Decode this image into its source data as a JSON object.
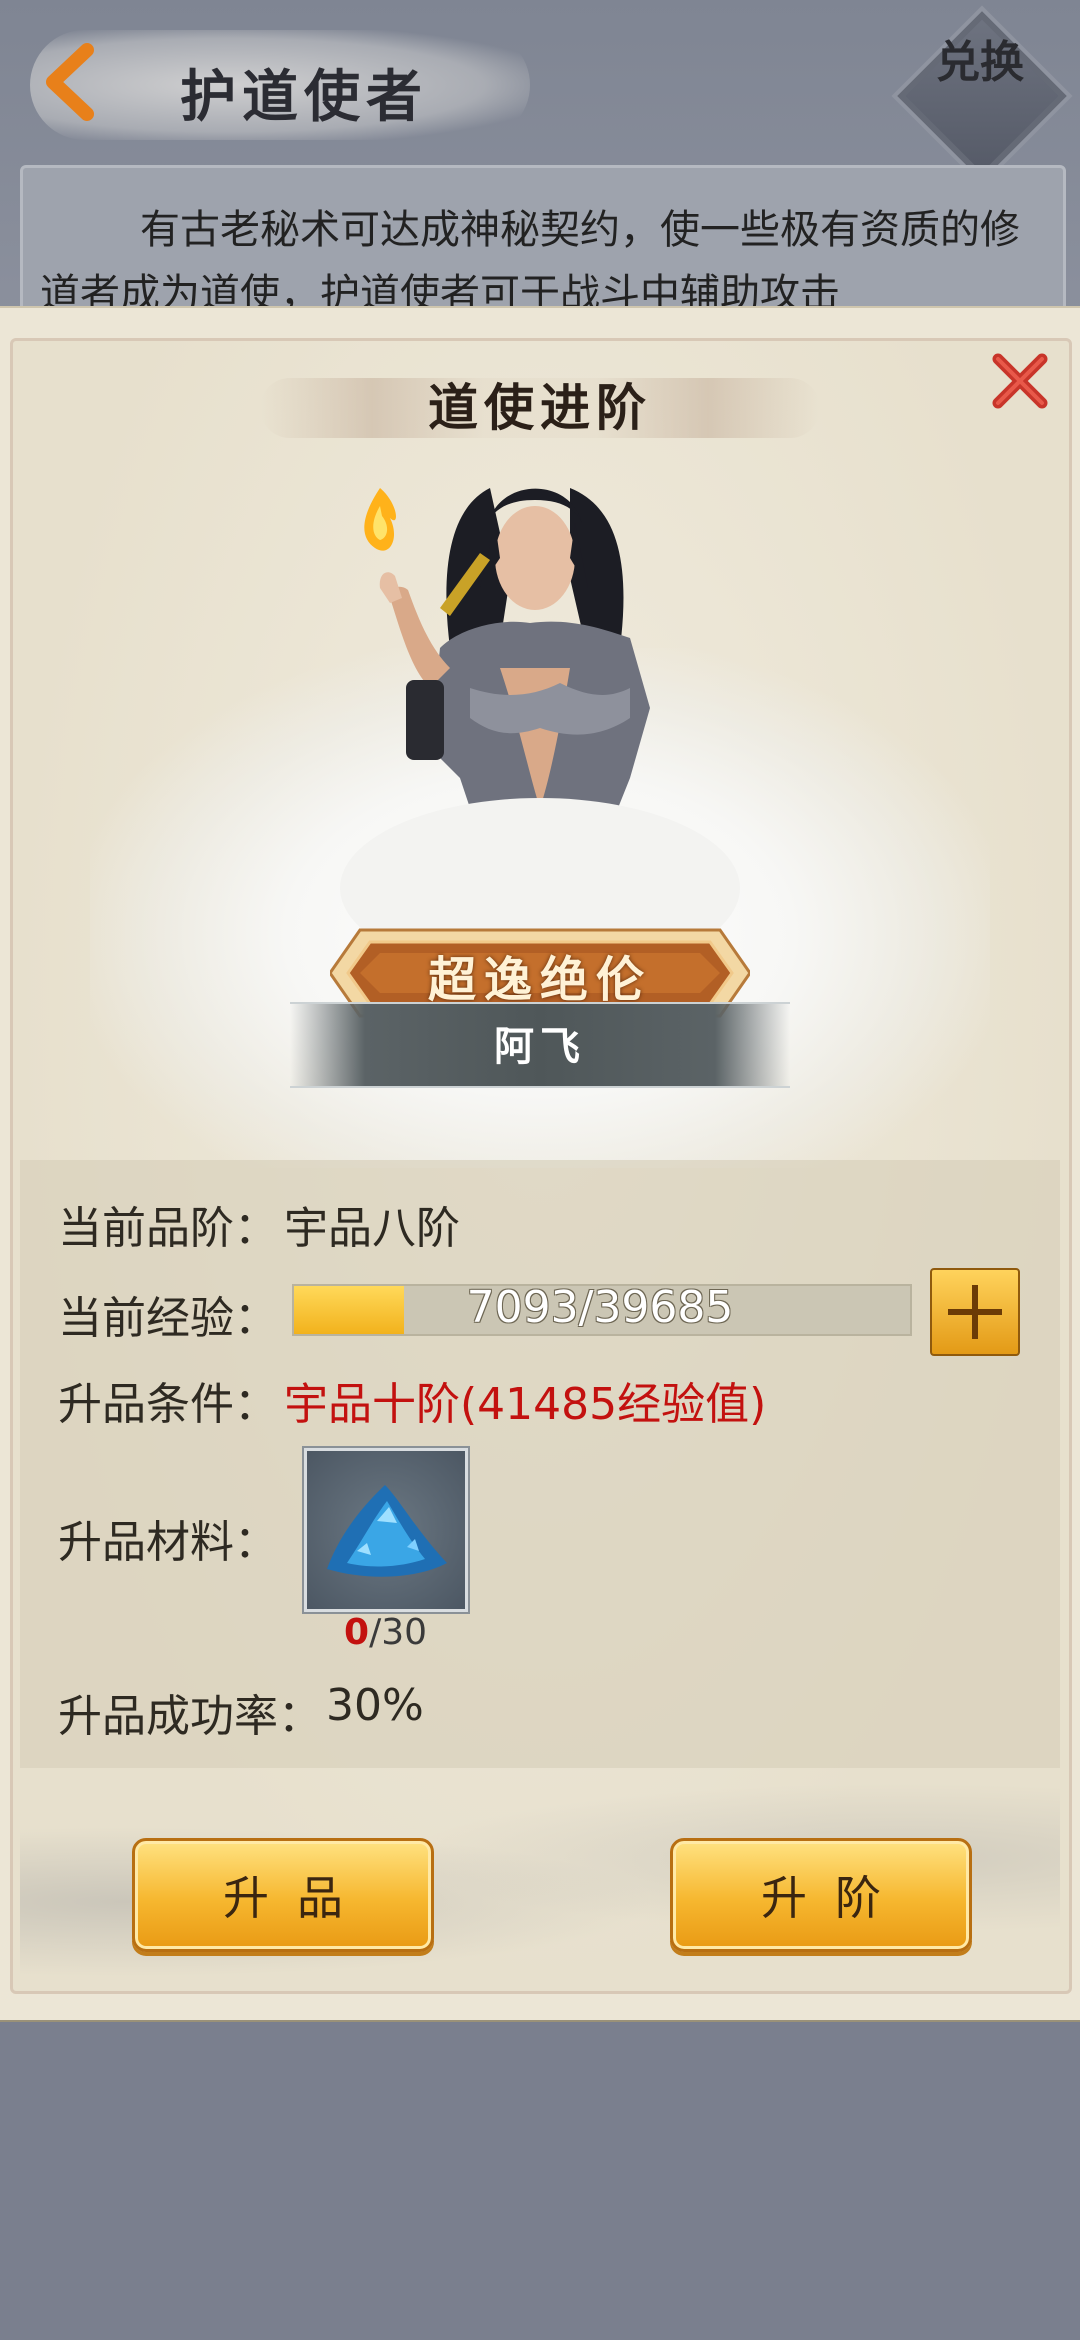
{
  "header": {
    "title": "护道使者",
    "exchange_label": "兑换",
    "description": "有古老秘术可达成神秘契约，使一些极有资质的修道者成为道使，护道使者可于战斗中辅助攻击"
  },
  "dialog": {
    "title": "道使进阶",
    "rank_badge": "超逸绝伦",
    "character_name": "阿飞",
    "current_grade": {
      "label": "当前品阶：",
      "value": "宇品八阶"
    },
    "current_exp": {
      "label": "当前经验：",
      "text": "7093/39685",
      "current": 7093,
      "max": 39685
    },
    "upgrade_condition": {
      "label": "升品条件：",
      "value": "宇品十阶(41485经验值)"
    },
    "material": {
      "label": "升品材料：",
      "have": "0",
      "need": "/30"
    },
    "success_rate": {
      "label": "升品成功率：",
      "value": "30%"
    },
    "buttons": {
      "upgrade_grade": "升品",
      "upgrade_rank": "升阶"
    }
  },
  "colors": {
    "accent_gold": "#f2b21c",
    "condition_red": "#c3110f",
    "overlay": "#7a7f8e"
  }
}
